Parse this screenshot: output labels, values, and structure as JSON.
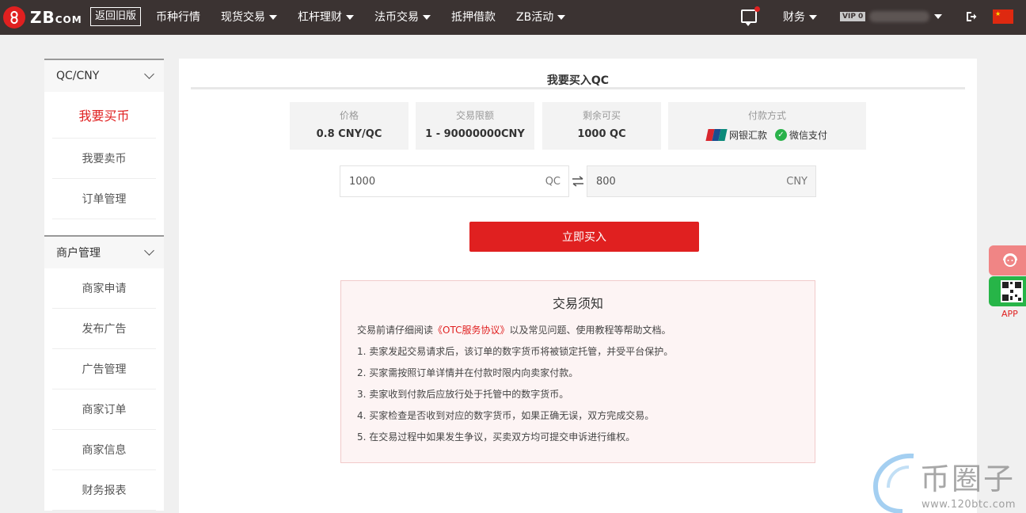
{
  "header": {
    "logo_text": "ZB",
    "logo_suffix": "COM",
    "old_version": "返回旧版",
    "nav": [
      {
        "label": "币种行情",
        "dropdown": false
      },
      {
        "label": "现货交易",
        "dropdown": true
      },
      {
        "label": "杠杆理财",
        "dropdown": true
      },
      {
        "label": "法币交易",
        "dropdown": true
      },
      {
        "label": "抵押借款",
        "dropdown": false
      },
      {
        "label": "ZB活动",
        "dropdown": true
      }
    ],
    "finance": "财务",
    "vip": "VIP 0",
    "icons": [
      "chat-icon",
      "logout-icon",
      "china-flag-icon"
    ]
  },
  "sidebar": {
    "groups": [
      {
        "title": "QC/CNY",
        "items": [
          "我要买币",
          "我要卖币",
          "订单管理"
        ],
        "active": 0
      },
      {
        "title": "商户管理",
        "items": [
          "商家申请",
          "发布广告",
          "广告管理",
          "商家订单",
          "商家信息",
          "财务报表"
        ]
      }
    ]
  },
  "main": {
    "title": "我要买入QC",
    "cards": [
      {
        "label": "价格",
        "value": "0.8 CNY/QC"
      },
      {
        "label": "交易限额",
        "value": "1 - 90000000CNY"
      },
      {
        "label": "剩余可买",
        "value": "1000 QC"
      }
    ],
    "payment": {
      "label": "付款方式",
      "unionpay": "网银汇款",
      "wechat": "微信支付"
    },
    "qc_amount": "1000",
    "qc_unit": "QC",
    "cny_amount": "800",
    "cny_unit": "CNY",
    "buy_button": "立即买入"
  },
  "notice": {
    "title": "交易须知",
    "intro_before": "交易前请仔细阅读",
    "intro_link": "《OTC服务协议》",
    "intro_after": "以及常见问题、使用教程等帮助文档。",
    "items": [
      "1. 卖家发起交易请求后，该订单的数字货币将被锁定托管，并受平台保护。",
      "2. 买家需按照订单详情并在付款时限内向卖家付款。",
      "3. 卖家收到付款后应放行处于托管中的数字货币。",
      "4. 买家检查是否收到对应的数字货币，如果正确无误，双方完成交易。",
      "5. 在交易过程中如果发生争议，买卖双方均可提交申诉进行维权。"
    ]
  },
  "float": {
    "app_label": "APP"
  },
  "watermark": {
    "text": "币圈子",
    "url": "www.120btc.com"
  },
  "colors": {
    "brand_red": "#e02020",
    "header_bg": "#3b3332",
    "wechat_green": "#2ab24b"
  }
}
